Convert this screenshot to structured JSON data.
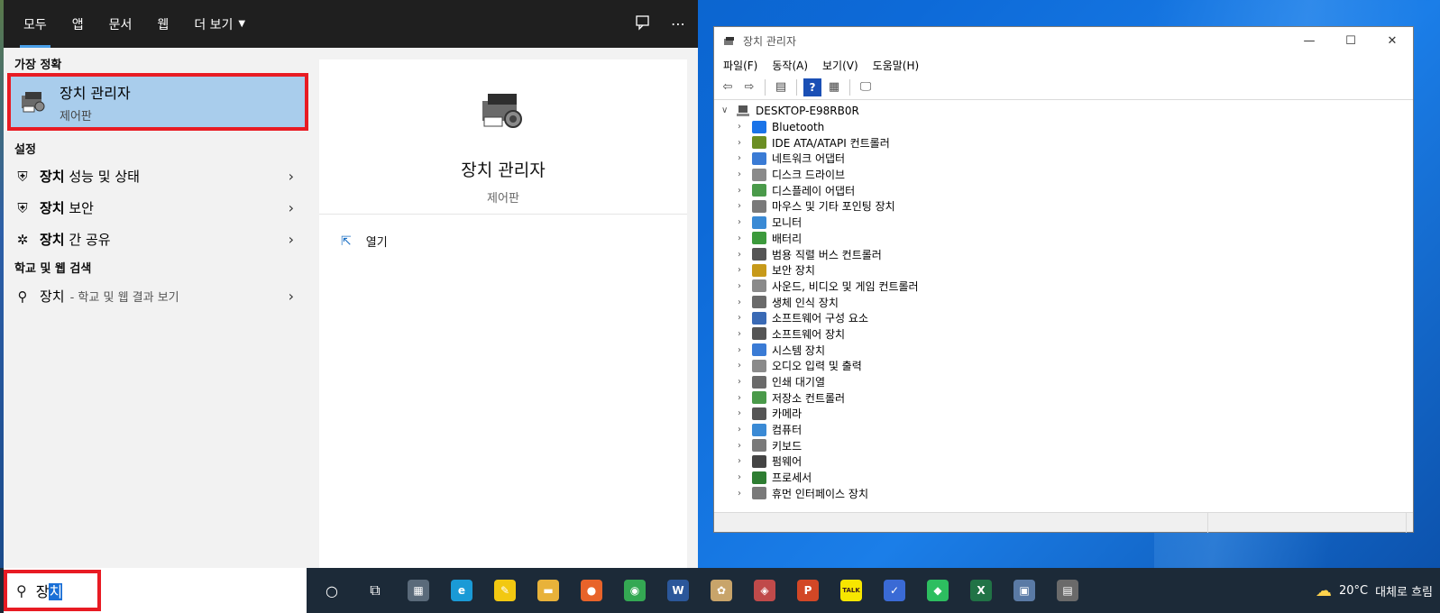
{
  "start": {
    "tabs": [
      {
        "label": "모두"
      },
      {
        "label": "앱"
      },
      {
        "label": "문서"
      },
      {
        "label": "웹"
      },
      {
        "label": "더 보기"
      }
    ],
    "best_match_header": "가장 정확",
    "best_match": {
      "title": "장치 관리자",
      "subtitle": "제어판"
    },
    "settings_header": "설정",
    "settings_items": [
      {
        "bold": "장치",
        "rest": " 성능 및 상태",
        "icon": "shield-icon"
      },
      {
        "bold": "장치",
        "rest": " 보안",
        "icon": "shield-icon"
      },
      {
        "bold": "장치",
        "rest": " 간 공유",
        "icon": "share-icon"
      }
    ],
    "web_header": "학교 및 웹 검색",
    "web_item": {
      "bold": "장치",
      "sub": "- 학교 및 웹 결과 보기"
    },
    "preview": {
      "title": "장치 관리자",
      "subtitle": "제어판",
      "open_label": "열기"
    }
  },
  "device_manager": {
    "title": "장치 관리자",
    "menus": [
      "파일(F)",
      "동작(A)",
      "보기(V)",
      "도움말(H)"
    ],
    "root": "DESKTOP-E98RB0R",
    "nodes": [
      {
        "label": "Bluetooth",
        "color": "#1a73e8"
      },
      {
        "label": "IDE ATA/ATAPI 컨트롤러",
        "color": "#6b8e23"
      },
      {
        "label": "네트워크 어댑터",
        "color": "#3a7bd5"
      },
      {
        "label": "디스크 드라이브",
        "color": "#8a8a8a"
      },
      {
        "label": "디스플레이 어댑터",
        "color": "#4a9a4a"
      },
      {
        "label": "마우스 및 기타 포인팅 장치",
        "color": "#7a7a7a"
      },
      {
        "label": "모니터",
        "color": "#3a8ad5"
      },
      {
        "label": "배터리",
        "color": "#3c9a3c"
      },
      {
        "label": "범용 직렬 버스 컨트롤러",
        "color": "#555555"
      },
      {
        "label": "보안 장치",
        "color": "#c79a1a"
      },
      {
        "label": "사운드, 비디오 및 게임 컨트롤러",
        "color": "#8a8a8a"
      },
      {
        "label": "생체 인식 장치",
        "color": "#6a6a6a"
      },
      {
        "label": "소프트웨어 구성 요소",
        "color": "#3a6ab5"
      },
      {
        "label": "소프트웨어 장치",
        "color": "#555555"
      },
      {
        "label": "시스템 장치",
        "color": "#3a7bd5"
      },
      {
        "label": "오디오 입력 및 출력",
        "color": "#8a8a8a"
      },
      {
        "label": "인쇄 대기열",
        "color": "#6a6a6a"
      },
      {
        "label": "저장소 컨트롤러",
        "color": "#4a9a4a"
      },
      {
        "label": "카메라",
        "color": "#555555"
      },
      {
        "label": "컴퓨터",
        "color": "#3a8ad5"
      },
      {
        "label": "키보드",
        "color": "#7a7a7a"
      },
      {
        "label": "펌웨어",
        "color": "#444444"
      },
      {
        "label": "프로세서",
        "color": "#2e7d32"
      },
      {
        "label": "휴먼 인터페이스 장치",
        "color": "#7a7a7a"
      }
    ]
  },
  "taskbar": {
    "search_typed": "장",
    "search_selected": "치",
    "apps": [
      {
        "name": "cortana-icon",
        "glyph": "○",
        "bg": "transparent"
      },
      {
        "name": "task-view-icon",
        "glyph": "⧉",
        "bg": "transparent"
      },
      {
        "name": "calculator-icon",
        "glyph": "▦",
        "bg": "#5a6a7a"
      },
      {
        "name": "edge-icon",
        "glyph": "e",
        "bg": "#1a9ad6"
      },
      {
        "name": "sticky-notes-icon",
        "glyph": "✎",
        "bg": "#f2c811"
      },
      {
        "name": "file-explorer-icon",
        "glyph": "▬",
        "bg": "#e8b23a"
      },
      {
        "name": "firefox-icon",
        "glyph": "●",
        "bg": "#e8632a"
      },
      {
        "name": "chrome-icon",
        "glyph": "◉",
        "bg": "#34a853"
      },
      {
        "name": "word-icon",
        "glyph": "W",
        "bg": "#2b579a"
      },
      {
        "name": "paint-icon",
        "glyph": "✿",
        "bg": "#c8a46a"
      },
      {
        "name": "satellite-icon",
        "glyph": "◈",
        "bg": "#c04a4a"
      },
      {
        "name": "powerpoint-icon",
        "glyph": "P",
        "bg": "#d24726"
      },
      {
        "name": "kakaotalk-icon",
        "glyph": "TALK",
        "bg": "#f7e600"
      },
      {
        "name": "utility-icon",
        "glyph": "✓",
        "bg": "#3a6ad5"
      },
      {
        "name": "evernote-icon",
        "glyph": "◆",
        "bg": "#2dbe60"
      },
      {
        "name": "excel-icon",
        "glyph": "X",
        "bg": "#217346"
      },
      {
        "name": "network-icon",
        "glyph": "▣",
        "bg": "#5a7aa5"
      },
      {
        "name": "device-manager-icon",
        "glyph": "▤",
        "bg": "#6a6a6a"
      }
    ],
    "temperature": "20°C",
    "weather_text": "대체로 흐림"
  }
}
